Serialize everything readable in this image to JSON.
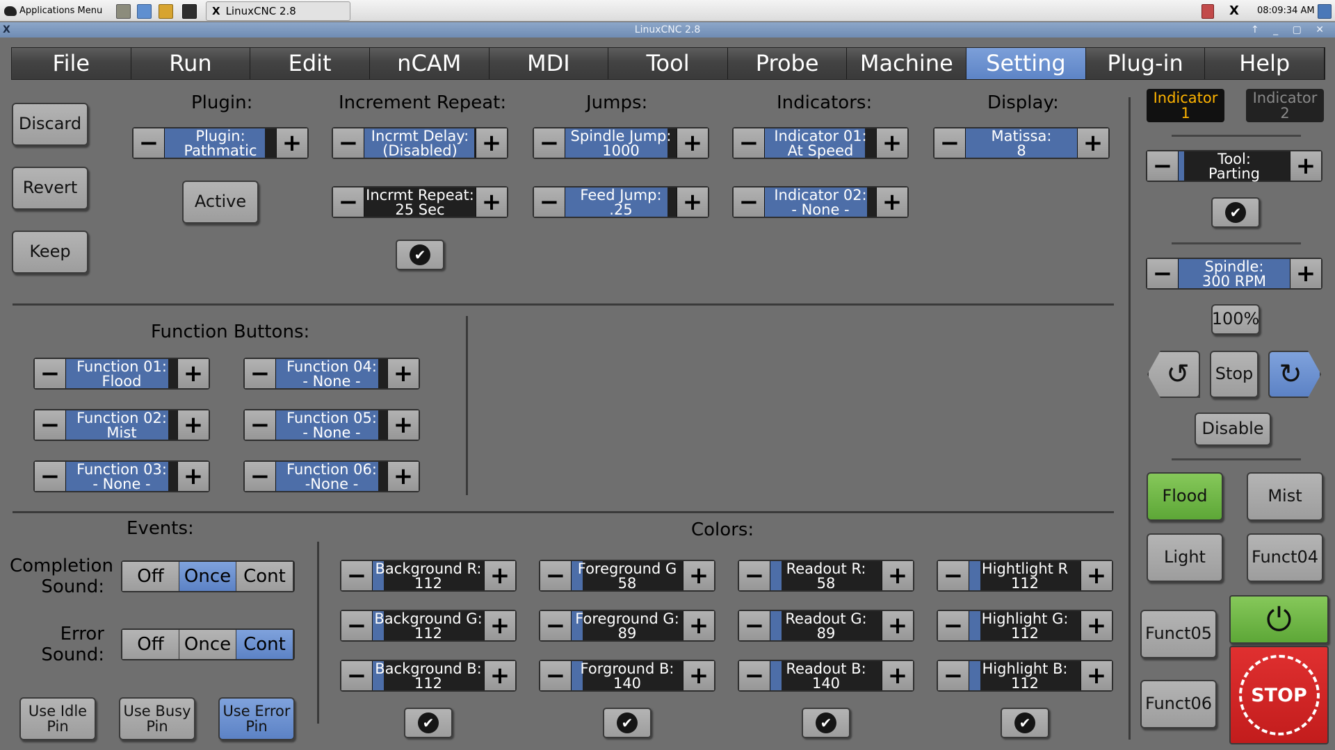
{
  "taskbar": {
    "apps_menu": "Applications Menu",
    "window_task": "LinuxCNC 2.8",
    "x_icon": "X",
    "clock": "08:09:34 AM"
  },
  "window": {
    "title": "LinuxCNC 2.8"
  },
  "menu": [
    "File",
    "Run",
    "Edit",
    "nCAM",
    "MDI",
    "Tool",
    "Probe",
    "Machine",
    "Setting",
    "Plug-in",
    "Help"
  ],
  "menu_active_index": 8,
  "left_buttons": {
    "discard": "Discard",
    "revert": "Revert",
    "keep": "Keep"
  },
  "plugin": {
    "header": "Plugin:",
    "spinner": {
      "line1": "Plugin:",
      "line2": "Pathmatic",
      "fill": 0.9
    },
    "active_button": "Active"
  },
  "increment_repeat": {
    "header": "Increment Repeat:",
    "delay": {
      "line1": "Incrmt Delay:",
      "line2": "(Disabled)",
      "fill": 0.99
    },
    "repeat": {
      "line1": "Incrmt Repeat:",
      "line2": "25 Sec",
      "fill": 0.0
    }
  },
  "jumps": {
    "header": "Jumps:",
    "spindle": {
      "line1": "Spindle Jump:",
      "line2": "1000",
      "fill": 0.92
    },
    "feed": {
      "line1": "Feed Jump:",
      "line2": ".25",
      "fill": 0.92
    }
  },
  "indicators": {
    "header": "Indicators:",
    "ind1": {
      "line1": "Indicator 01:",
      "line2": "At Speed",
      "fill": 0.9
    },
    "ind2": {
      "line1": "Indicator 02:",
      "line2": "- None -",
      "fill": 0.92
    }
  },
  "display": {
    "header": "Display:",
    "matissa": {
      "line1": "Matissa:",
      "line2": "8",
      "fill": 1.0
    }
  },
  "function_buttons": {
    "header": "Function Buttons:",
    "items": [
      {
        "line1": "Function 01:",
        "line2": "Flood",
        "fill": 0.92
      },
      {
        "line1": "Function 02:",
        "line2": "Mist",
        "fill": 0.92
      },
      {
        "line1": "Function 03:",
        "line2": "- None -",
        "fill": 0.92
      },
      {
        "line1": "Function 04:",
        "line2": "- None -",
        "fill": 0.92
      },
      {
        "line1": "Function 05:",
        "line2": "- None -",
        "fill": 0.92
      },
      {
        "line1": "Function 06:",
        "line2": "-None -",
        "fill": 0.92
      }
    ]
  },
  "events": {
    "header": "Events:",
    "completion_label": "Completion\nSound:",
    "error_label": "Error\nSound:",
    "options": [
      "Off",
      "Once",
      "Cont"
    ],
    "completion_selected": 1,
    "error_selected": 2,
    "pins": [
      "Use Idle\nPin",
      "Use Busy\nPin",
      "Use Error\nPin"
    ],
    "pins_active": 2
  },
  "colors": {
    "header": "Colors:",
    "items": [
      {
        "line1": "Background R:",
        "line2": "112",
        "fill": 0.1
      },
      {
        "line1": "Background G:",
        "line2": "112",
        "fill": 0.1
      },
      {
        "line1": "Background B:",
        "line2": "112",
        "fill": 0.1
      },
      {
        "line1": "Foreground G",
        "line2": "58",
        "fill": 0.1
      },
      {
        "line1": "Foreground  G:",
        "line2": "89",
        "fill": 0.1
      },
      {
        "line1": "Forground B:",
        "line2": "140",
        "fill": 0.1
      },
      {
        "line1": "Readout R:",
        "line2": "58",
        "fill": 0.1
      },
      {
        "line1": "Readout G:",
        "line2": "89",
        "fill": 0.1
      },
      {
        "line1": "Readout B:",
        "line2": "140",
        "fill": 0.1
      },
      {
        "line1": "Hightlight R",
        "line2": "112",
        "fill": 0.1
      },
      {
        "line1": "Highlight G:",
        "line2": "112",
        "fill": 0.1
      },
      {
        "line1": "Highlight B:",
        "line2": "112",
        "fill": 0.1
      }
    ]
  },
  "right_panel": {
    "indicator1": "Indicator\n1",
    "indicator2": "Indicator\n2",
    "tool": {
      "line1": "Tool:",
      "line2": "Parting",
      "fill": 0.05
    },
    "spindle": {
      "line1": "Spindle:",
      "line2": "300 RPM",
      "fill": 1.0
    },
    "override": "100%",
    "stop": "Stop",
    "disable": "Disable",
    "flood": "Flood",
    "mist": "Mist",
    "light": "Light",
    "funct04": "Funct04",
    "funct05": "Funct05",
    "funct06": "Funct06",
    "estop": "STOP"
  },
  "colors_theme": {
    "accent": "#5c82c5",
    "green": "#5da737",
    "estop": "#d42626",
    "indicator_on": "#ffb400"
  }
}
